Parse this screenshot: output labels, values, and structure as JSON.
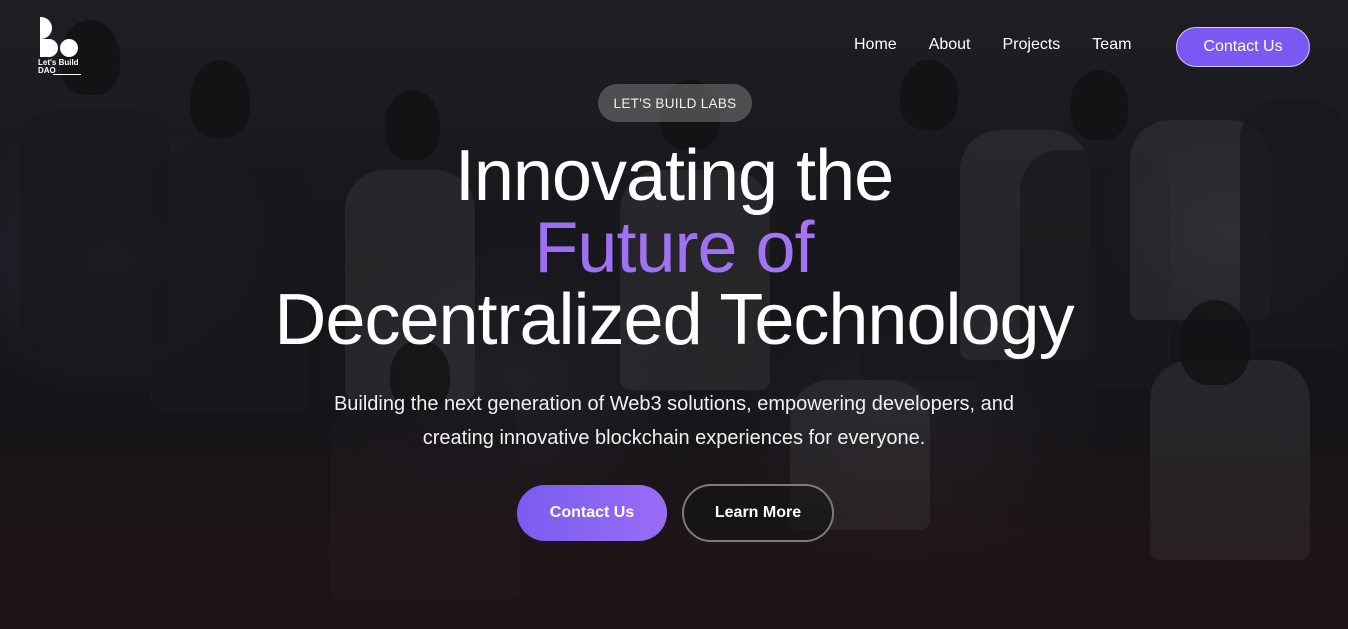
{
  "brand": {
    "logo_line1": "Let's Build",
    "logo_line2": "DAO"
  },
  "nav": {
    "items": [
      {
        "label": "Home"
      },
      {
        "label": "About"
      },
      {
        "label": "Projects"
      },
      {
        "label": "Team"
      }
    ],
    "contact_label": "Contact Us"
  },
  "hero": {
    "badge": "LET'S BUILD LABS",
    "headline_line1": "Innovating the",
    "headline_line2": "Future of",
    "headline_line3": "Decentralized Technology",
    "subtitle_line1": "Building the next generation of Web3 solutions, empowering developers, and",
    "subtitle_line2": "creating innovative blockchain experiences for everyone.",
    "primary_cta": "Contact Us",
    "secondary_cta": "Learn More"
  },
  "colors": {
    "accent": "#7c58f3",
    "accent_gradient_end": "#b57af3",
    "background": "#1b1a1e"
  }
}
